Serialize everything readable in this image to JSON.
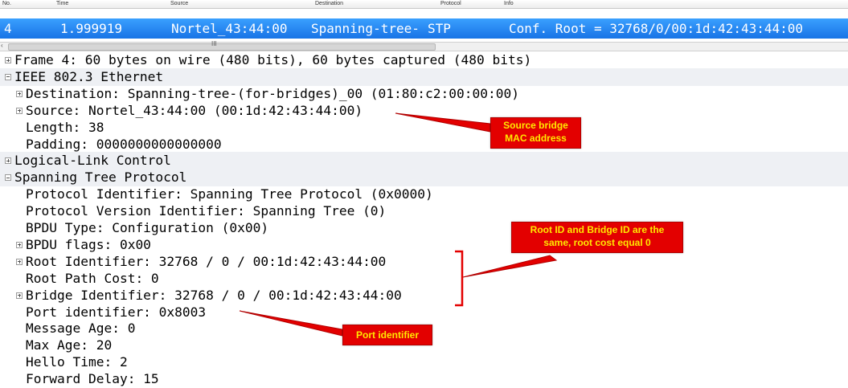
{
  "columns": {
    "no": "No.",
    "time": "Time",
    "source": "Source",
    "destination": "Destination",
    "protocol": "Protocol",
    "info": "Info"
  },
  "selected_packet": {
    "no": "4",
    "time": "1.999919",
    "source": "Nortel_43:44:00",
    "destination": "Spanning-tree-",
    "protocol": "STP",
    "info": "Conf. Root = 32768/0/00:1d:42:43:44:00"
  },
  "scrollbar": {
    "grip": "III"
  },
  "tree": [
    {
      "text": "Frame 4: 60 bytes on wire (480 bits), 60 bytes captured (480 bits)",
      "expander": "plus",
      "indent": 0,
      "shaded": false
    },
    {
      "text": "IEEE 802.3 Ethernet",
      "expander": "minus",
      "indent": 0,
      "shaded": true
    },
    {
      "text": "Destination: Spanning-tree-(for-bridges)_00 (01:80:c2:00:00:00)",
      "expander": "plus",
      "indent": 1,
      "shaded": false
    },
    {
      "text": "Source: Nortel_43:44:00 (00:1d:42:43:44:00)",
      "expander": "plus",
      "indent": 1,
      "shaded": false
    },
    {
      "text": "Length: 38",
      "expander": "none",
      "indent": 1,
      "shaded": false
    },
    {
      "text": "Padding: 0000000000000000",
      "expander": "none",
      "indent": 1,
      "shaded": false
    },
    {
      "text": "Logical-Link Control",
      "expander": "plus",
      "indent": 0,
      "shaded": true
    },
    {
      "text": "Spanning Tree Protocol",
      "expander": "minus",
      "indent": 0,
      "shaded": true
    },
    {
      "text": "Protocol Identifier: Spanning Tree Protocol (0x0000)",
      "expander": "none",
      "indent": 1,
      "shaded": false
    },
    {
      "text": "Protocol Version Identifier: Spanning Tree (0)",
      "expander": "none",
      "indent": 1,
      "shaded": false
    },
    {
      "text": "BPDU Type: Configuration (0x00)",
      "expander": "none",
      "indent": 1,
      "shaded": false
    },
    {
      "text": "BPDU flags: 0x00",
      "expander": "plus",
      "indent": 1,
      "shaded": false
    },
    {
      "text": "Root Identifier: 32768 / 0 / 00:1d:42:43:44:00",
      "expander": "plus",
      "indent": 1,
      "shaded": false
    },
    {
      "text": "Root Path Cost: 0",
      "expander": "none",
      "indent": 1,
      "shaded": false
    },
    {
      "text": "Bridge Identifier: 32768 / 0 / 00:1d:42:43:44:00",
      "expander": "plus",
      "indent": 1,
      "shaded": false
    },
    {
      "text": "Port identifier: 0x8003",
      "expander": "none",
      "indent": 1,
      "shaded": false
    },
    {
      "text": "Message Age: 0",
      "expander": "none",
      "indent": 1,
      "shaded": false
    },
    {
      "text": "Max Age: 20",
      "expander": "none",
      "indent": 1,
      "shaded": false
    },
    {
      "text": "Hello Time: 2",
      "expander": "none",
      "indent": 1,
      "shaded": false
    },
    {
      "text": "Forward Delay: 15",
      "expander": "none",
      "indent": 1,
      "shaded": false
    }
  ],
  "annotations": {
    "source_bridge": {
      "line1": "Source bridge",
      "line2": "MAC address"
    },
    "root_bridge": {
      "line1": "Root ID and Bridge ID are the",
      "line2": "same, root cost equal 0"
    },
    "port_id": {
      "line1": "Port identifier"
    }
  },
  "colors": {
    "selection": "#1e90ff",
    "callout_bg": "#e30000",
    "callout_text": "#ffe800",
    "arrow": "#e30000",
    "bracket": "#e30000"
  }
}
